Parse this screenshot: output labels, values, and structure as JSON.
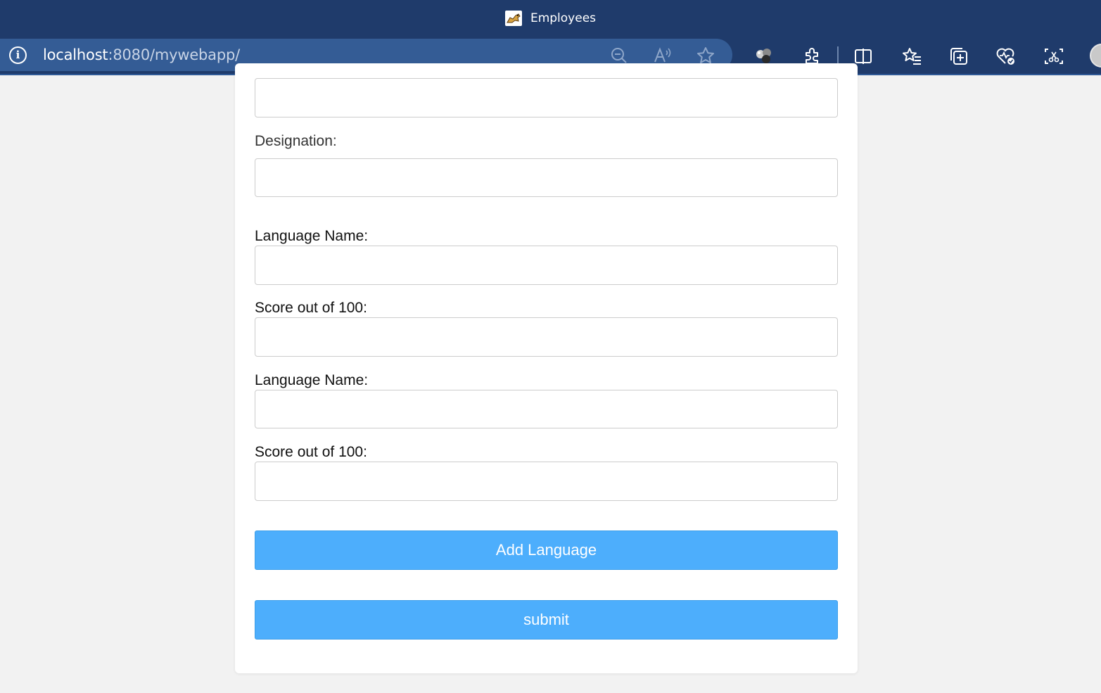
{
  "browser": {
    "tab_title": "Employees",
    "url_host": "localhost",
    "url_rest": ":8080/mywebapp/",
    "icons": [
      "info-icon",
      "zoom-out-icon",
      "read-aloud-icon",
      "favorite-star-icon",
      "extension-spheres-icon",
      "extensions-puzzle-icon",
      "split-screen-icon",
      "favorites-list-icon",
      "collections-icon",
      "browser-health-icon",
      "screenshot-icon",
      "profile-avatar"
    ]
  },
  "form": {
    "designation_label": "Designation:",
    "languages": [
      {
        "name_label": "Language Name:",
        "score_label": "Score out of 100:"
      },
      {
        "name_label": "Language Name:",
        "score_label": "Score out of 100:"
      }
    ],
    "add_language_label": "Add Language",
    "submit_label": "submit"
  },
  "colors": {
    "chrome": "#1f3b6b",
    "address_bar": "#345c95",
    "button": "#4daefc",
    "page_bg": "#f2f2f2"
  }
}
